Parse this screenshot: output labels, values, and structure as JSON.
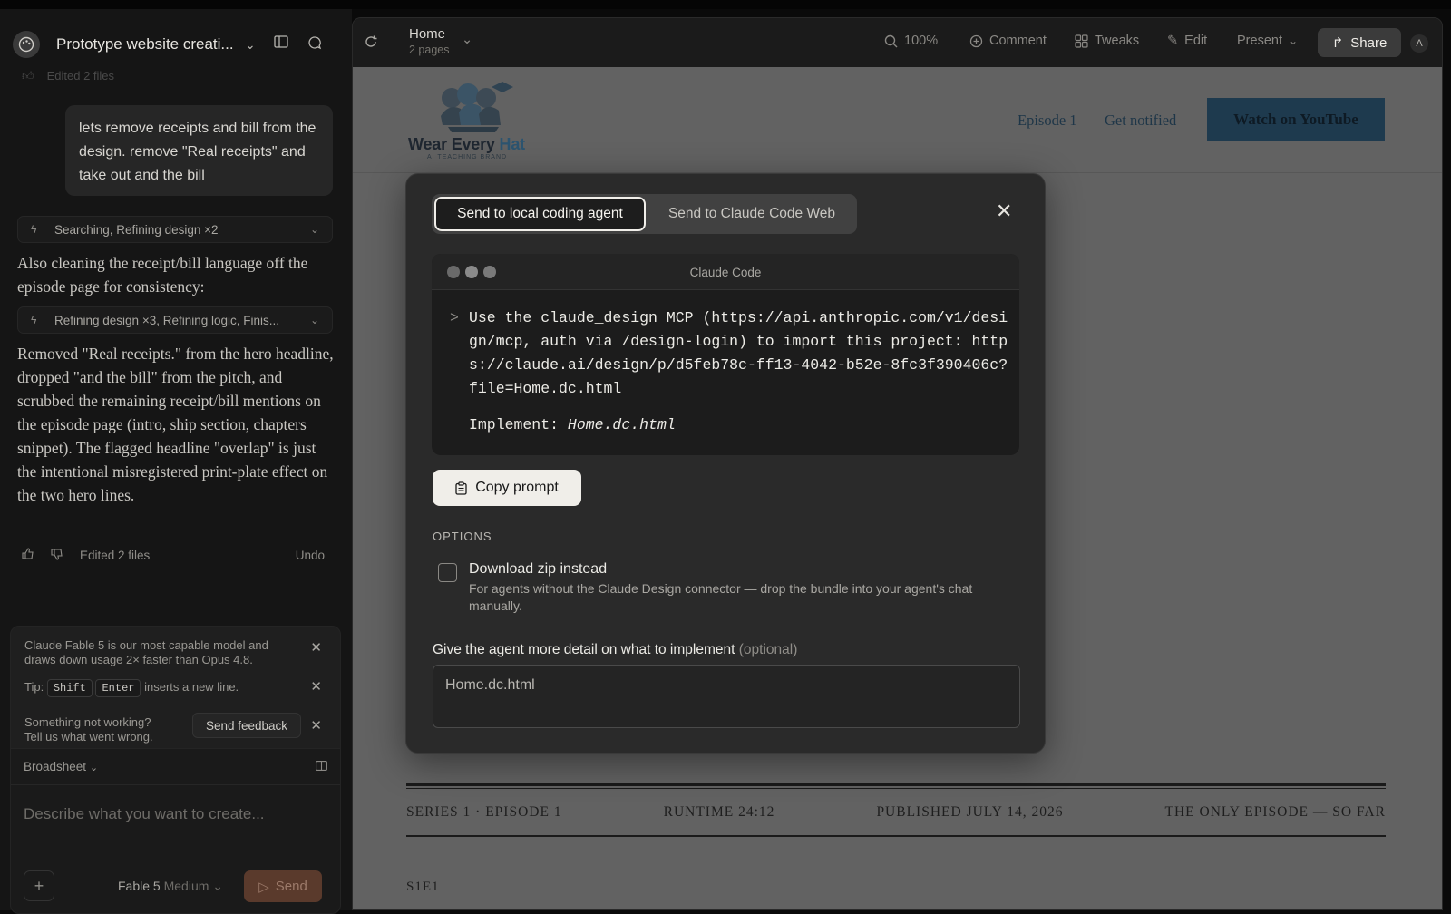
{
  "sidebar": {
    "project_title": "Prototype website creati...",
    "faded_row_text": "Edited 2 files",
    "user_message": "lets remove receipts and bill from the design.   remove \"Real receipts\" and take out and the bill",
    "tool_row_1": "Searching, Refining design ×2",
    "assistant_text_1": "Also cleaning the receipt/bill language off the episode page for consistency:",
    "tool_row_2": "Refining design ×3, Refining logic, Finis...",
    "assistant_text_2": "Removed \"Real receipts.\" from the hero headline, dropped \"and the bill\" from the pitch, and scrubbed the remaining receipt/bill mentions on the episode page (intro, ship section, chapters snippet). The flagged headline \"overlap\" is just the intentional misregistered print-plate effect on the two hero lines.",
    "edited_label": "Edited 2 files",
    "undo_label": "Undo",
    "notice_model": "Claude Fable 5 is our most capable model and draws down usage 2× faster than Opus 4.8.",
    "tip_prefix": "Tip:",
    "tip_key1": "Shift",
    "tip_key2": "Enter",
    "tip_suffix": "inserts a new line.",
    "feedback_line1": "Something not working?",
    "feedback_line2": "Tell us what went wrong.",
    "feedback_button": "Send feedback",
    "composer_mode": "Broadsheet",
    "composer_placeholder": "Describe what you want to create...",
    "model_name": "Fable 5",
    "model_quality": "Medium",
    "send_label": "Send"
  },
  "toolbar": {
    "page_title": "Home",
    "page_count": "2 pages",
    "zoom": "100%",
    "comment": "Comment",
    "tweaks": "Tweaks",
    "edit": "Edit",
    "present": "Present",
    "share": "Share",
    "avatar_initial": "A"
  },
  "site": {
    "brand_name_a": "Wear Every ",
    "brand_name_b": "Hat",
    "brand_tagline": "AI TEACHING BRAND",
    "nav_episode": "Episode 1",
    "nav_notified": "Get notified",
    "nav_youtube": "Watch on YouTube",
    "meta_series": "SERIES 1 · EPISODE 1",
    "meta_runtime": "RUNTIME 24:12",
    "meta_published": "PUBLISHED JULY 14, 2026",
    "meta_only": "THE ONLY EPISODE — SO FAR",
    "episode_code": "S1E1"
  },
  "modal": {
    "tab_local": "Send to local coding agent",
    "tab_web": "Send to Claude Code Web",
    "terminal_title": "Claude Code",
    "prompt_symbol": ">",
    "command": "Use the claude_design MCP (https://api.anthropic.com/v1/design/mcp, auth via /design-login) to import this project: https://claude.ai/design/p/d5feb78c-ff13-4042-b52e-8fc3f390406c?file=Home.dc.html",
    "implement_label": "Implement: ",
    "implement_file": "Home.dc.html",
    "copy_label": "Copy prompt",
    "options_heading": "OPTIONS",
    "download_title": "Download zip instead",
    "download_desc": "For agents without the Claude Design connector — drop the bundle into your agent's chat manually.",
    "detail_label": "Give the agent more detail on what to implement",
    "detail_optional": "(optional)",
    "detail_value": "Home.dc.html"
  },
  "colors": {
    "accent_brand": "#1e3a4e",
    "send_button": "#5a3a2c",
    "modal_bg": "#2a2a2a"
  }
}
